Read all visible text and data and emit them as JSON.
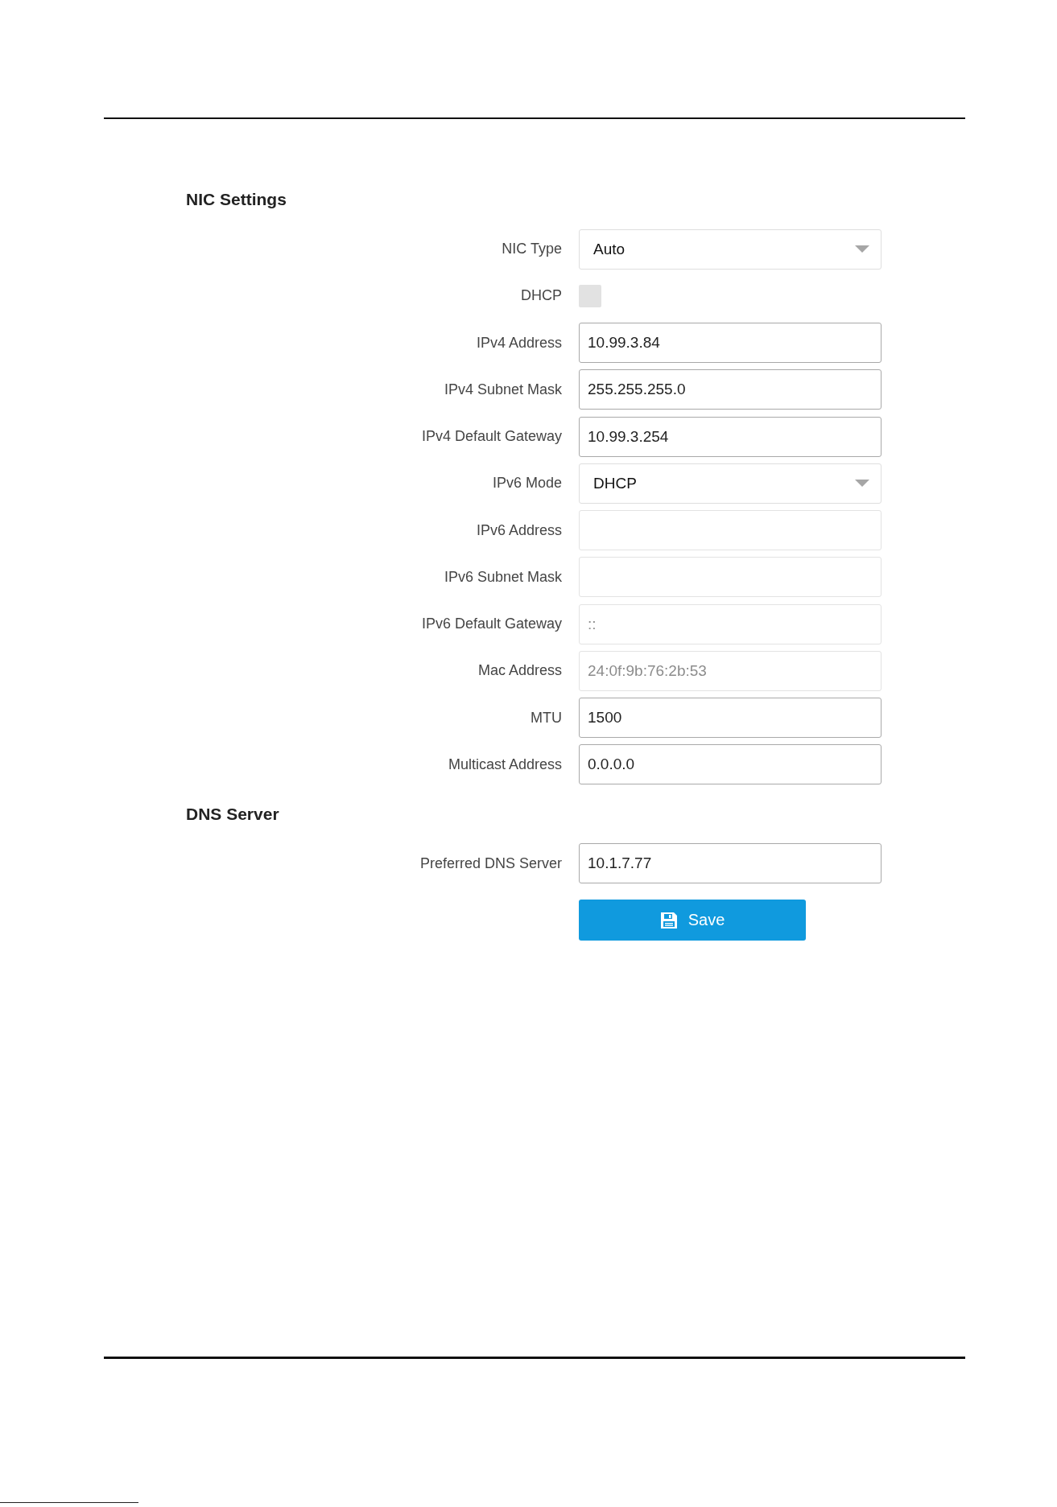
{
  "sections": [
    {
      "title": "NIC Settings",
      "fields": [
        {
          "kind": "select",
          "label": "NIC Type",
          "value": "Auto"
        },
        {
          "kind": "checkbox",
          "label": "DHCP",
          "checked": false
        },
        {
          "kind": "text",
          "label": "IPv4 Address",
          "value": "10.99.3.84",
          "disabled": false
        },
        {
          "kind": "text",
          "label": "IPv4 Subnet Mask",
          "value": "255.255.255.0",
          "disabled": false
        },
        {
          "kind": "text",
          "label": "IPv4 Default Gateway",
          "value": "10.99.3.254",
          "disabled": false
        },
        {
          "kind": "select",
          "label": "IPv6 Mode",
          "value": "DHCP"
        },
        {
          "kind": "text",
          "label": "IPv6 Address",
          "disabled": true
        },
        {
          "kind": "text",
          "label": "IPv6 Subnet Mask",
          "disabled": true
        },
        {
          "kind": "text",
          "label": "IPv6 Default Gateway",
          "value": "::",
          "disabled": true
        },
        {
          "kind": "text",
          "label": "Mac Address",
          "value": "24:0f:9b:76:2b:53",
          "disabled": true
        },
        {
          "kind": "text",
          "label": "MTU",
          "value": "1500",
          "disabled": false
        },
        {
          "kind": "text",
          "label": "Multicast Address",
          "value": "0.0.0.0",
          "disabled": false
        }
      ]
    },
    {
      "title": "DNS Server",
      "fields": [
        {
          "kind": "text",
          "label": "Preferred DNS Server",
          "value": "10.1.7.77",
          "disabled": false
        }
      ]
    }
  ],
  "save_button": {
    "label": "Save"
  }
}
